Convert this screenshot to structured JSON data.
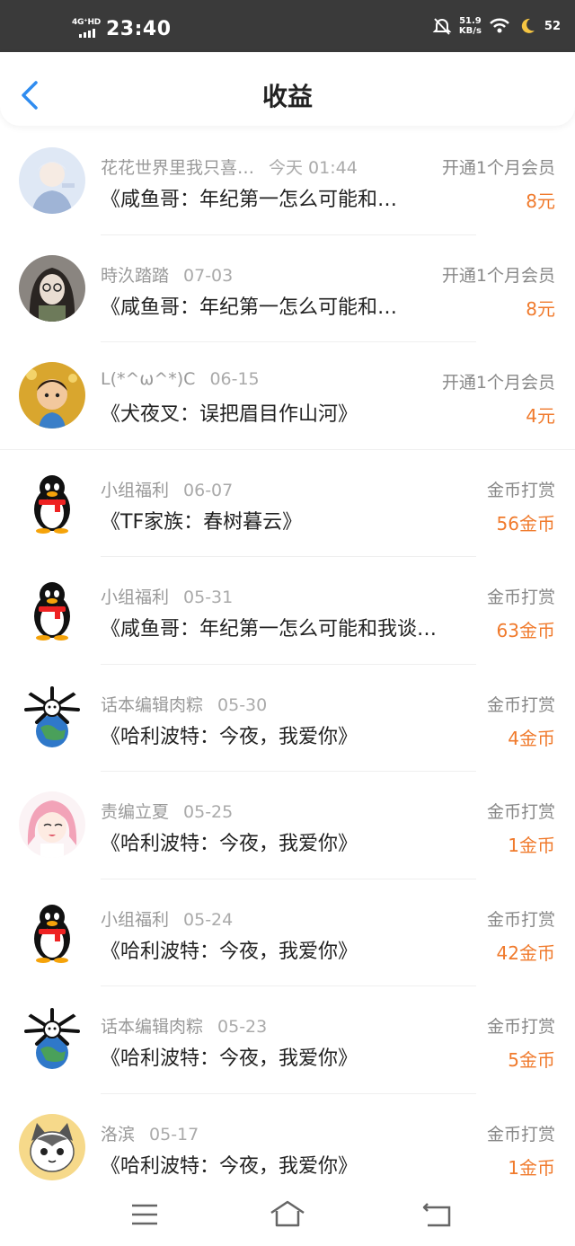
{
  "status_bar": {
    "network": "4G⁺HD",
    "time": "23:40",
    "speed_value": "51.9",
    "speed_unit": "KB/s",
    "battery": "52"
  },
  "header": {
    "title": "收益"
  },
  "earnings": [
    {
      "user": "花花世界里我只喜…",
      "date": "今天 01:44",
      "book": "《咸鱼哥：年纪第一怎么可能和…",
      "type": "开通1个月会员",
      "amount": "8元",
      "avatar": "anime-boy-avatar"
    },
    {
      "user": "時汣踏踏",
      "date": "07-03",
      "book": "《咸鱼哥：年纪第一怎么可能和…",
      "type": "开通1个月会员",
      "amount": "8元",
      "avatar": "girl-glasses-avatar"
    },
    {
      "user": "L(*^ω^*)C",
      "date": "06-15",
      "book": "《犬夜叉：误把眉目作山河》",
      "type": "开通1个月会员",
      "amount": "4元",
      "avatar": "cartoon-boy-avatar"
    },
    {
      "user": "小组福利",
      "date": "06-07",
      "book": "《TF家族：春树暮云》",
      "type": "金币打赏",
      "amount": "56金币",
      "avatar": "qq-penguin-avatar"
    },
    {
      "user": "小组福利",
      "date": "05-31",
      "book": "《咸鱼哥：年纪第一怎么可能和我谈…",
      "type": "金币打赏",
      "amount": "63金币",
      "avatar": "qq-penguin-avatar"
    },
    {
      "user": "话本编辑肉粽",
      "date": "05-30",
      "book": "《哈利波特：今夜，我爱你》",
      "type": "金币打赏",
      "amount": "4金币",
      "avatar": "globe-dog-avatar"
    },
    {
      "user": "责编立夏",
      "date": "05-25",
      "book": "《哈利波特：今夜，我爱你》",
      "type": "金币打赏",
      "amount": "1金币",
      "avatar": "pink-hair-girl-avatar"
    },
    {
      "user": "小组福利",
      "date": "05-24",
      "book": "《哈利波特：今夜，我爱你》",
      "type": "金币打赏",
      "amount": "42金币",
      "avatar": "qq-penguin-avatar"
    },
    {
      "user": "话本编辑肉粽",
      "date": "05-23",
      "book": "《哈利波特：今夜，我爱你》",
      "type": "金币打赏",
      "amount": "5金币",
      "avatar": "globe-dog-avatar"
    },
    {
      "user": "洛滨",
      "date": "05-17",
      "book": "《哈利波特：今夜，我爱你》",
      "type": "金币打赏",
      "amount": "1金币",
      "avatar": "cat-avatar"
    }
  ],
  "colors": {
    "accent": "#2f8cf0",
    "amount": "#f07a2c",
    "statusbar": "#3a3a3a"
  },
  "nav": {
    "menu_icon": "menu-icon",
    "home_icon": "home-icon",
    "back_icon": "return-icon"
  }
}
